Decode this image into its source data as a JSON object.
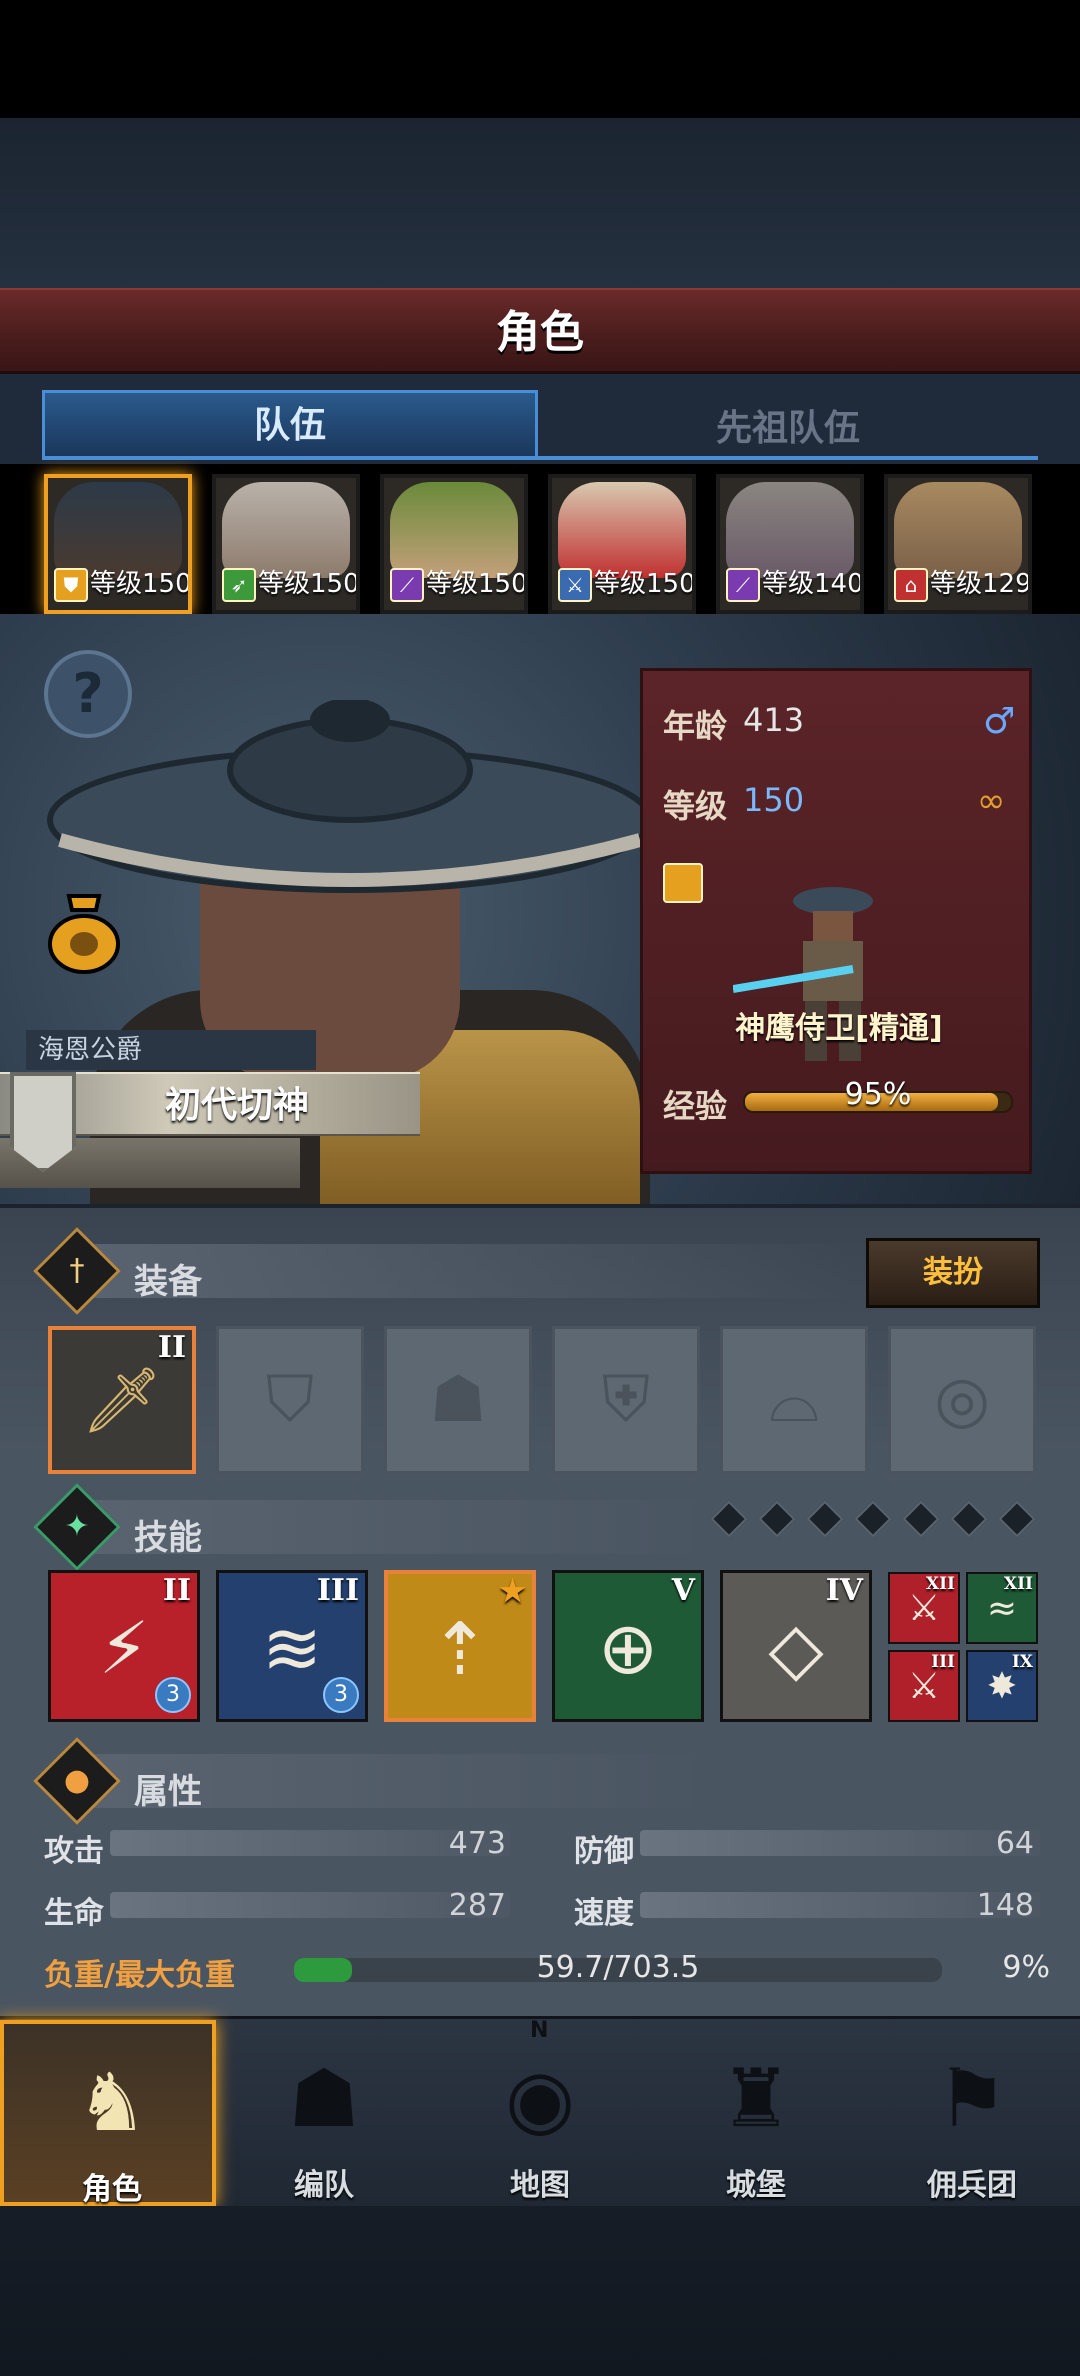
{
  "header": {
    "title": "角色"
  },
  "tabs": {
    "team": "队伍",
    "ancestor": "先祖队伍"
  },
  "portraits": [
    {
      "level_text": "等级150",
      "icon": "shield-star-icon",
      "selected": true
    },
    {
      "level_text": "等级150",
      "icon": "bow-icon",
      "selected": false
    },
    {
      "level_text": "等级150",
      "icon": "staff-icon",
      "selected": false
    },
    {
      "level_text": "等级150",
      "icon": "sword-icon",
      "selected": false
    },
    {
      "level_text": "等级140",
      "icon": "staff-icon",
      "selected": false
    },
    {
      "level_text": "等级129",
      "icon": "house-icon",
      "selected": false
    }
  ],
  "hero": {
    "title": "海恩公爵",
    "name": "初代切神",
    "age_label": "年龄",
    "age": "413",
    "level_label": "等级",
    "level": "150",
    "class_name": "神鹰侍卫[精通]",
    "exp_label": "经验",
    "exp": "95%",
    "exp_fraction": 0.95
  },
  "equipment": {
    "title": "装备",
    "outfit_button": "装扮",
    "slots": [
      {
        "icon": "sword-icon",
        "filled": true,
        "rank": "II"
      },
      {
        "icon": "shield-icon",
        "filled": false
      },
      {
        "icon": "helmet-icon",
        "filled": false
      },
      {
        "icon": "armor-icon",
        "filled": false
      },
      {
        "icon": "boots-icon",
        "filled": false
      },
      {
        "icon": "ring-icon",
        "filled": false
      }
    ]
  },
  "skills": {
    "title": "技能",
    "list": [
      {
        "rank": "II",
        "badge": "3",
        "icon": "slash-icon",
        "color": "#b8202a"
      },
      {
        "rank": "III",
        "badge": "3",
        "icon": "claw-icon",
        "color": "#23406e"
      },
      {
        "rank": "",
        "icon": "blade-up-icon",
        "color": "#c08a18"
      },
      {
        "rank": "V",
        "icon": "target-icon",
        "color": "#1e5a36"
      },
      {
        "rank": "IV",
        "icon": "crystal-icon",
        "color": "#5c5a56"
      }
    ],
    "mini": [
      {
        "rank": "XII",
        "icon": "sword-icon",
        "color": "#b0202a"
      },
      {
        "rank": "XII",
        "icon": "wave-icon",
        "color": "#1e5a36"
      },
      {
        "rank": "III",
        "icon": "sword-icon",
        "color": "#b0202a"
      },
      {
        "rank": "IX",
        "icon": "burst-icon",
        "color": "#23406e"
      }
    ]
  },
  "attributes": {
    "title": "属性",
    "attack_label": "攻击",
    "attack": "473",
    "defense_label": "防御",
    "defense": "64",
    "hp_label": "生命",
    "hp": "287",
    "speed_label": "速度",
    "speed": "148",
    "load_label": "负重/最大负重",
    "load": "59.7/703.5",
    "load_pct": "9%",
    "load_fraction": 0.09
  },
  "nav": [
    {
      "label": "角色",
      "icon": "knight-icon",
      "active": true
    },
    {
      "label": "编队",
      "icon": "helmet-icon",
      "active": false
    },
    {
      "label": "地图",
      "icon": "compass-icon",
      "active": false
    },
    {
      "label": "城堡",
      "icon": "castle-icon",
      "active": false
    },
    {
      "label": "佣兵团",
      "icon": "banner-icon",
      "active": false
    }
  ],
  "compass_letter": "N",
  "colors": {
    "accent": "#f0a020",
    "tab_blue": "#4a8ed8",
    "header_red": "#5a2222"
  }
}
